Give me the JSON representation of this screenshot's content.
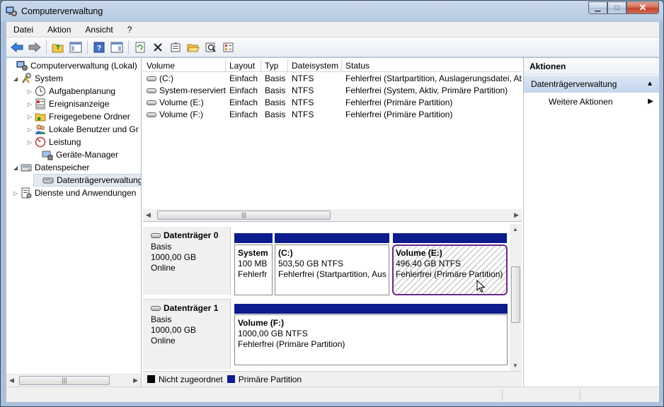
{
  "window": {
    "title": "Computerverwaltung"
  },
  "menu": [
    "Datei",
    "Aktion",
    "Ansicht",
    "?"
  ],
  "toolbar_icons": [
    "back-arrow-icon",
    "forward-arrow-icon",
    "up-folder-icon",
    "show-hide-tree-icon",
    "help-icon",
    "show-hide-action-icon",
    "refresh-icon",
    "delete-icon",
    "properties-icon",
    "open-folder-icon",
    "rescan-disk-icon",
    "properties-check-icon"
  ],
  "tree": {
    "root": "Computerverwaltung (Lokal)",
    "system": "System",
    "system_items": [
      "Aufgabenplanung",
      "Ereignisanzeige",
      "Freigegebene Ordner",
      "Lokale Benutzer und Gr",
      "Leistung",
      "Geräte-Manager"
    ],
    "storage": "Datenspeicher",
    "disk_mgmt": "Datenträgerverwaltung",
    "services": "Dienste und Anwendungen"
  },
  "volumes": {
    "headers": [
      "Volume",
      "Layout",
      "Typ",
      "Dateisystem",
      "Status"
    ],
    "rows": [
      [
        "(C:)",
        "Einfach",
        "Basis",
        "NTFS",
        "Fehlerfrei (Startpartition, Auslagerungsdatei, Ab"
      ],
      [
        "System-reserviert",
        "Einfach",
        "Basis",
        "NTFS",
        "Fehlerfrei (System, Aktiv, Primäre Partition)"
      ],
      [
        "Volume (E:)",
        "Einfach",
        "Basis",
        "NTFS",
        "Fehlerfrei (Primäre Partition)"
      ],
      [
        "Volume (F:)",
        "Einfach",
        "Basis",
        "NTFS",
        "Fehlerfrei (Primäre Partition)"
      ]
    ]
  },
  "disks": [
    {
      "name": "Datenträger 0",
      "type": "Basis",
      "size": "1000,00 GB",
      "state": "Online",
      "partitions": [
        {
          "name": "System",
          "size": "100 MB",
          "status": "Fehlerfr"
        },
        {
          "name": "(C:)",
          "size": "503,50 GB NTFS",
          "status": "Fehlerfrei (Startpartition, Aus"
        },
        {
          "name": "Volume  (E:)",
          "size": "496,40 GB NTFS",
          "status": "Fehlerfrei (Primäre Partition)"
        }
      ]
    },
    {
      "name": "Datenträger 1",
      "type": "Basis",
      "size": "1000,00 GB",
      "state": "Online",
      "partitions": [
        {
          "name": "Volume  (F:)",
          "size": "1000,00 GB NTFS",
          "status": "Fehlerfrei (Primäre Partition)"
        }
      ]
    }
  ],
  "legend": {
    "unallocated": "Nicht zugeordnet",
    "primary": "Primäre Partition",
    "unallocated_color": "#000000",
    "primary_color": "#0c1c8c"
  },
  "actions": {
    "header": "Aktionen",
    "section": "Datenträgerverwaltung",
    "item": "Weitere Aktionen"
  },
  "colors": {
    "partition_band": "#0c1c8c",
    "selection_outline": "#6a2a8a"
  }
}
